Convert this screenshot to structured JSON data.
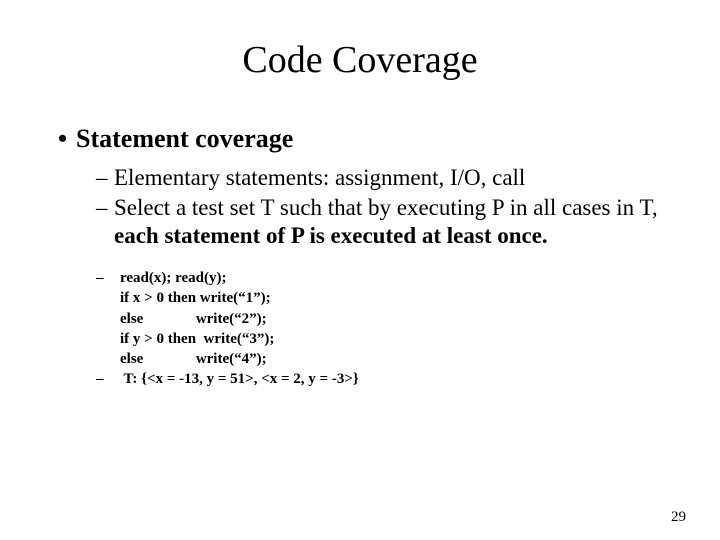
{
  "title": "Code Coverage",
  "level1": {
    "bullet": "•",
    "text": "Statement coverage"
  },
  "level2": [
    {
      "dash": "–",
      "text": "Elementary statements: assignment, I/O, call"
    },
    {
      "dash": "–",
      "text_prefix": "Select a test set T such that by executing P in all cases in T, ",
      "text_bold": "each statement of P is executed at least once."
    }
  ],
  "code": {
    "first": {
      "dash": "–",
      "text": "read(x); read(y);"
    },
    "lines": [
      "if x > 0 then write(“1”);",
      "else              write(“2”);",
      "if y > 0 then  write(“3”);",
      "else              write(“4”);"
    ],
    "last": {
      "dash": "–",
      "text": " T: {<x = -13, y = 51>, <x = 2, y = -3>}"
    }
  },
  "page_number": "29"
}
